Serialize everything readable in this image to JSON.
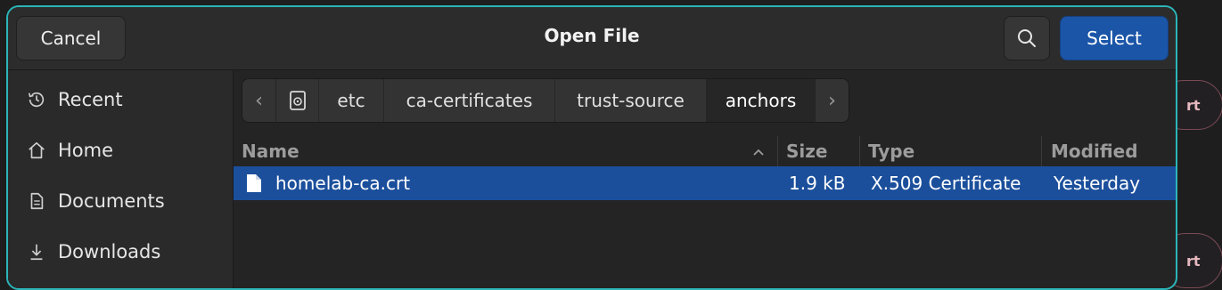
{
  "background": {
    "pill1_text": "rt",
    "pill2_text": "rt"
  },
  "header": {
    "cancel_label": "Cancel",
    "title": "Open File",
    "search_icon": "search-icon",
    "select_label": "Select"
  },
  "sidebar": {
    "items": [
      {
        "label": "Recent",
        "icon": "clock-history-icon"
      },
      {
        "label": "Home",
        "icon": "home-icon"
      },
      {
        "label": "Documents",
        "icon": "document-icon"
      },
      {
        "label": "Downloads",
        "icon": "download-icon"
      }
    ]
  },
  "pathbar": {
    "back_icon": "chevron-left-icon",
    "root_icon": "drive-icon",
    "segments": [
      "etc",
      "ca-certificates",
      "trust-source",
      "anchors"
    ],
    "forward_icon": "chevron-right-icon"
  },
  "columns": {
    "name": "Name",
    "size": "Size",
    "type": "Type",
    "modified": "Modified",
    "sort_icon": "sort-ascending-icon"
  },
  "files": [
    {
      "name": "homelab-ca.crt",
      "size": "1.9 kB",
      "type": "X.509 Certificate",
      "modified": "Yesterday",
      "icon": "file-icon",
      "selected": true
    }
  ],
  "colors": {
    "accent": "#1b55a8",
    "selection": "#1b4f9c",
    "focus_border": "#2bb5b8"
  }
}
